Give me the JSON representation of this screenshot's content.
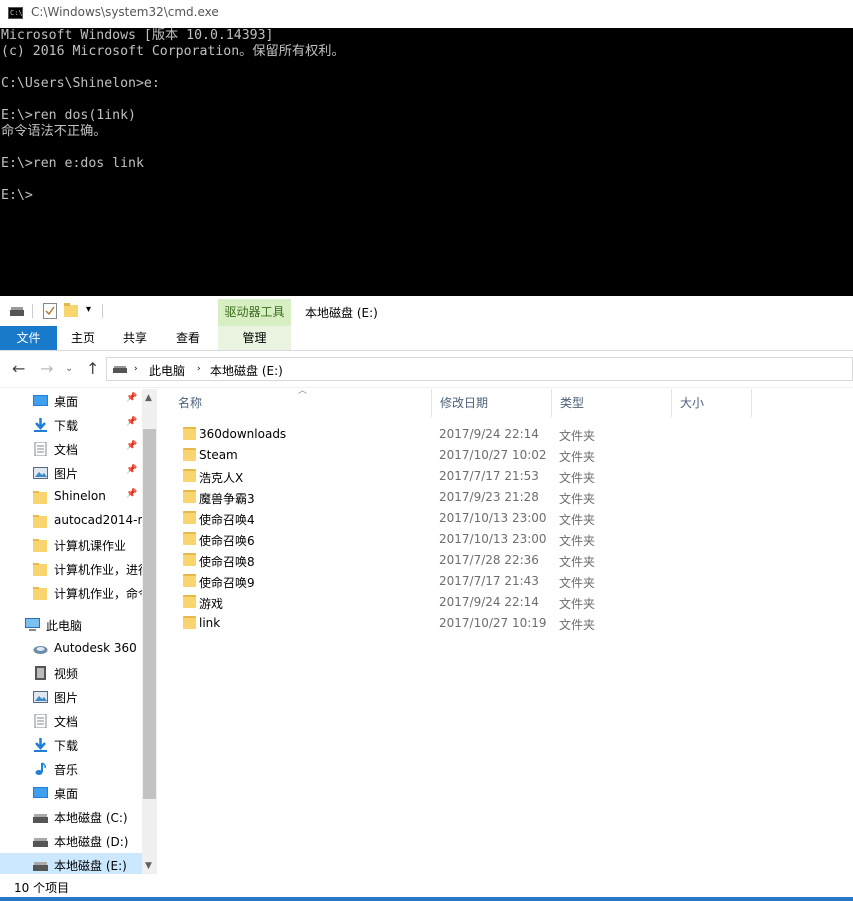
{
  "cmd": {
    "title": "C:\\Windows\\system32\\cmd.exe",
    "icon_label": "C:\\",
    "lines": "Microsoft Windows [版本 10.0.14393]\n(c) 2016 Microsoft Corporation。保留所有权利。\n\nC:\\Users\\Shinelon>e:\n\nE:\\>ren dos(1ink)\n命令语法不正确。\n\nE:\\>ren e:dos link\n\nE:\\>"
  },
  "ribbon": {
    "tabs": [
      "文件",
      "主页",
      "共享",
      "查看",
      "管理"
    ],
    "context_group": "驱动器工具",
    "window_title": "本地磁盘 (E:)"
  },
  "address": {
    "crumbs": [
      "此电脑",
      "本地磁盘 (E:)"
    ]
  },
  "nav": {
    "items": [
      {
        "label": "桌面",
        "icon": "desktop-icon",
        "pinned": true
      },
      {
        "label": "下载",
        "icon": "download-icon",
        "pinned": true
      },
      {
        "label": "文档",
        "icon": "documents-icon",
        "pinned": true
      },
      {
        "label": "图片",
        "icon": "pictures-icon",
        "pinned": true
      },
      {
        "label": "Shinelon",
        "icon": "folder-icon",
        "pinned": true
      },
      {
        "label": "autocad2014-r",
        "icon": "folder-icon"
      },
      {
        "label": "计算机课作业",
        "icon": "folder-icon"
      },
      {
        "label": "计算机作业，进行",
        "icon": "folder-icon"
      },
      {
        "label": "计算机作业，命令",
        "icon": "folder-icon"
      },
      {
        "label": "此电脑",
        "icon": "this-pc-icon"
      },
      {
        "label": "Autodesk 360",
        "icon": "cloud-icon"
      },
      {
        "label": "视频",
        "icon": "video-icon"
      },
      {
        "label": "图片",
        "icon": "pictures-icon"
      },
      {
        "label": "文档",
        "icon": "documents-icon"
      },
      {
        "label": "下载",
        "icon": "download-icon"
      },
      {
        "label": "音乐",
        "icon": "music-icon"
      },
      {
        "label": "桌面",
        "icon": "desktop-icon"
      },
      {
        "label": "本地磁盘 (C:)",
        "icon": "drive-icon"
      },
      {
        "label": "本地磁盘 (D:)",
        "icon": "drive-icon"
      },
      {
        "label": "本地磁盘 (E:)",
        "icon": "drive-icon",
        "selected": true
      }
    ]
  },
  "columns": [
    "名称",
    "修改日期",
    "类型",
    "大小"
  ],
  "files": [
    {
      "name": "360downloads",
      "date": "2017/9/24 22:14",
      "type": "文件夹"
    },
    {
      "name": "Steam",
      "date": "2017/10/27 10:02",
      "type": "文件夹"
    },
    {
      "name": "浩克人X",
      "date": "2017/7/17 21:53",
      "type": "文件夹"
    },
    {
      "name": "魔兽争霸3",
      "date": "2017/9/23 21:28",
      "type": "文件夹"
    },
    {
      "name": "使命召唤4",
      "date": "2017/10/13 23:00",
      "type": "文件夹"
    },
    {
      "name": "使命召唤6",
      "date": "2017/10/13 23:00",
      "type": "文件夹"
    },
    {
      "name": "使命召唤8",
      "date": "2017/7/28 22:36",
      "type": "文件夹"
    },
    {
      "name": "使命召唤9",
      "date": "2017/7/17 21:43",
      "type": "文件夹"
    },
    {
      "name": "游戏",
      "date": "2017/9/24 22:14",
      "type": "文件夹"
    },
    {
      "name": "link",
      "date": "2017/10/27 10:19",
      "type": "文件夹"
    }
  ],
  "status": "10 个项目"
}
